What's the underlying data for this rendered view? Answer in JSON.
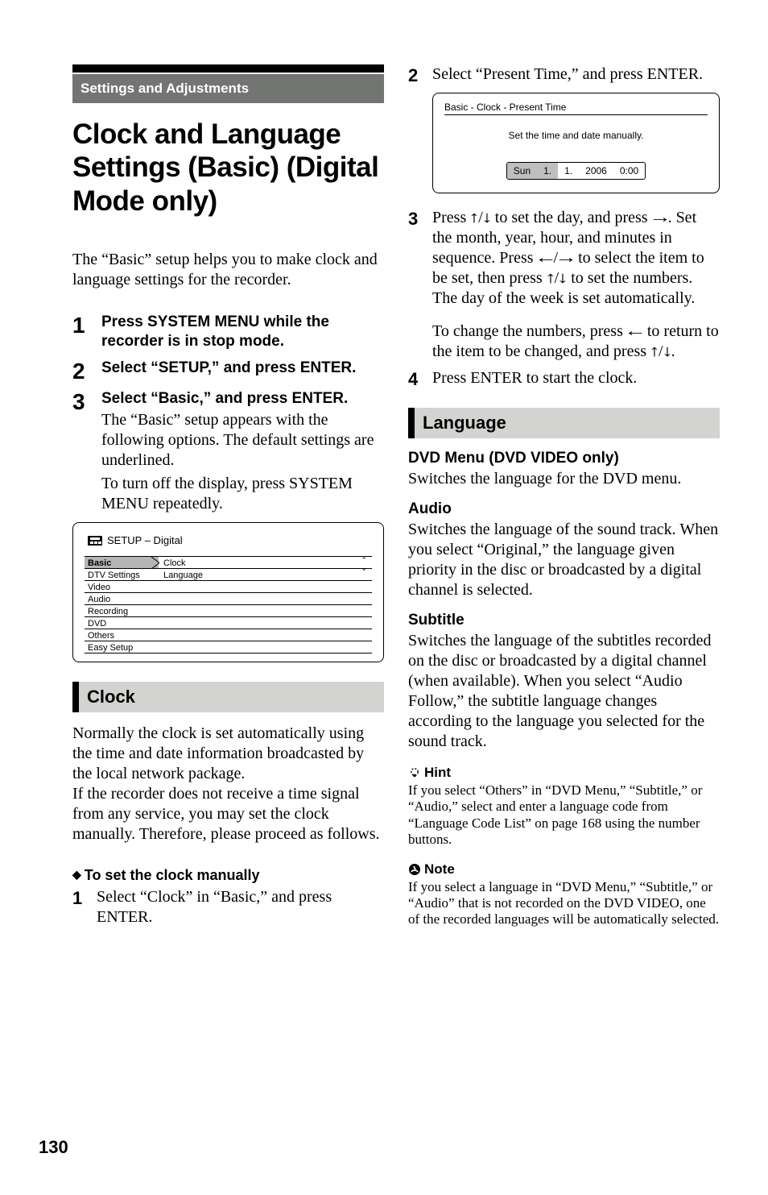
{
  "page_number": "130",
  "section_band": "Settings and Adjustments",
  "title": "Clock and Language Settings (Basic) (Digital Mode only)",
  "intro": "The “Basic” setup helps you to make clock and language settings for the recorder.",
  "steps": [
    {
      "num": "1",
      "head": "Press SYSTEM MENU while the recorder is in stop mode."
    },
    {
      "num": "2",
      "head": "Select “SETUP,” and press ENTER."
    },
    {
      "num": "3",
      "head": "Select “Basic,” and press ENTER.",
      "body1": "The “Basic” setup appears with the following options. The default settings are underlined.",
      "body2": "To turn off the display, press SYSTEM MENU repeatedly."
    }
  ],
  "setup_screen": {
    "title": "SETUP – Digital",
    "left": [
      "Basic",
      "DTV Settings",
      "Video",
      "Audio",
      "Recording",
      "DVD",
      "Others",
      "Easy Setup"
    ],
    "right": [
      "Clock",
      "Language"
    ]
  },
  "clock": {
    "heading": "Clock",
    "p1": "Normally the clock is set automatically using the time and date information broadcasted by the local network package.",
    "p2": "If the recorder does not receive a time signal from any service, you may set the clock manually. Therefore, please proceed as follows.",
    "manual_head": "To set the clock manually",
    "s1": {
      "num": "1",
      "txt": "Select “Clock” in “Basic,” and press ENTER."
    }
  },
  "right_col": {
    "s2": {
      "num": "2",
      "txt": "Select “Present Time,” and press ENTER."
    },
    "time_screen": {
      "crumb": "Basic - Clock - Present Time",
      "msg": "Set the time and date manually.",
      "cells": [
        "Sun",
        "1.",
        "1.",
        "2006",
        "0:00"
      ]
    },
    "s3": {
      "num": "3",
      "l1_a": "Press ",
      "l1_arrows1": "↑/↓",
      "l1_b": " to set the day, and press ",
      "l1_arrows2": "→",
      "l1_c": ". Set the month, year, hour, and minutes in sequence. Press ",
      "l1_arrows3": "←/→",
      "l1_d": " to select the item to be set, then press ",
      "l1_arrows4": "↑/↓",
      "l1_e": " to set the numbers. The day of the week is set automatically.",
      "p2a": "To change the numbers, press ",
      "p2arrow": "←",
      "p2b": " to return to the item to be changed, and press ",
      "p2arrow2": "↑/↓",
      "p2c": "."
    },
    "s4": {
      "num": "4",
      "txt": "Press ENTER to start the clock."
    }
  },
  "language": {
    "heading": "Language",
    "dvd_head": "DVD Menu (DVD VIDEO only)",
    "dvd_body": "Switches the language for the DVD menu.",
    "audio_head": "Audio",
    "audio_body": "Switches the language of the sound track. When you select “Original,” the language given priority in the disc or broadcasted by a digital channel is selected.",
    "sub_head": "Subtitle",
    "sub_body": "Switches the language of the subtitles recorded on the disc or broadcasted by a digital channel (when available). When you select “Audio Follow,” the subtitle language changes according to the language you selected for the sound track.",
    "hint_label": "Hint",
    "hint_body": "If you select “Others” in “DVD Menu,” “Subtitle,” or “Audio,” select and enter a language code from “Language Code List” on page 168 using the number buttons.",
    "note_label": "Note",
    "note_body": "If you select a language in “DVD Menu,” “Subtitle,” or “Audio” that is not recorded on the DVD VIDEO, one of the recorded languages will be automatically selected."
  }
}
